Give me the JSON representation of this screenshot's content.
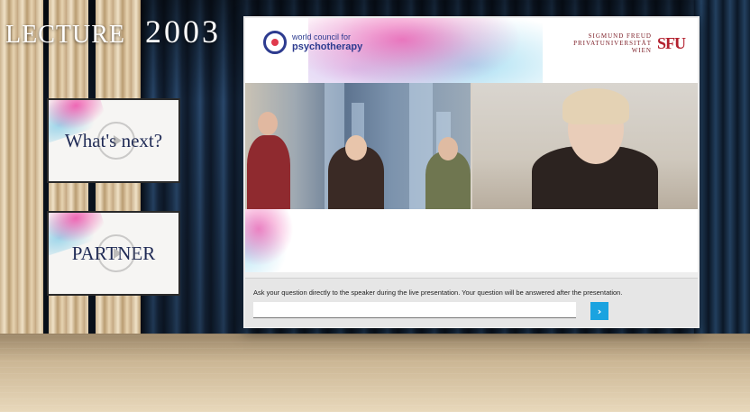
{
  "header": {
    "title_word": "LECTURE",
    "title_number": "2003"
  },
  "side_cards": [
    {
      "label": "What's next?"
    },
    {
      "label": "PARTNER"
    }
  ],
  "banner": {
    "wcp_line1": "world council for",
    "wcp_line2": "psychotherapy",
    "sfu_line1": "SIGMUND FREUD",
    "sfu_line2": "PRIVATUNIVERSITÄT",
    "sfu_line3": "WIEN",
    "sfu_mark": "SFU"
  },
  "qa": {
    "prompt": "Ask your question directly to the speaker during the live presentation. Your question will be answered after the presentation.",
    "input_value": "",
    "send_icon": "›"
  },
  "colors": {
    "accent_blue": "#1aa3e0",
    "brand_navy": "#2d3b8f",
    "sfu_red": "#b3202e",
    "splash_pink": "#ec50aa"
  }
}
